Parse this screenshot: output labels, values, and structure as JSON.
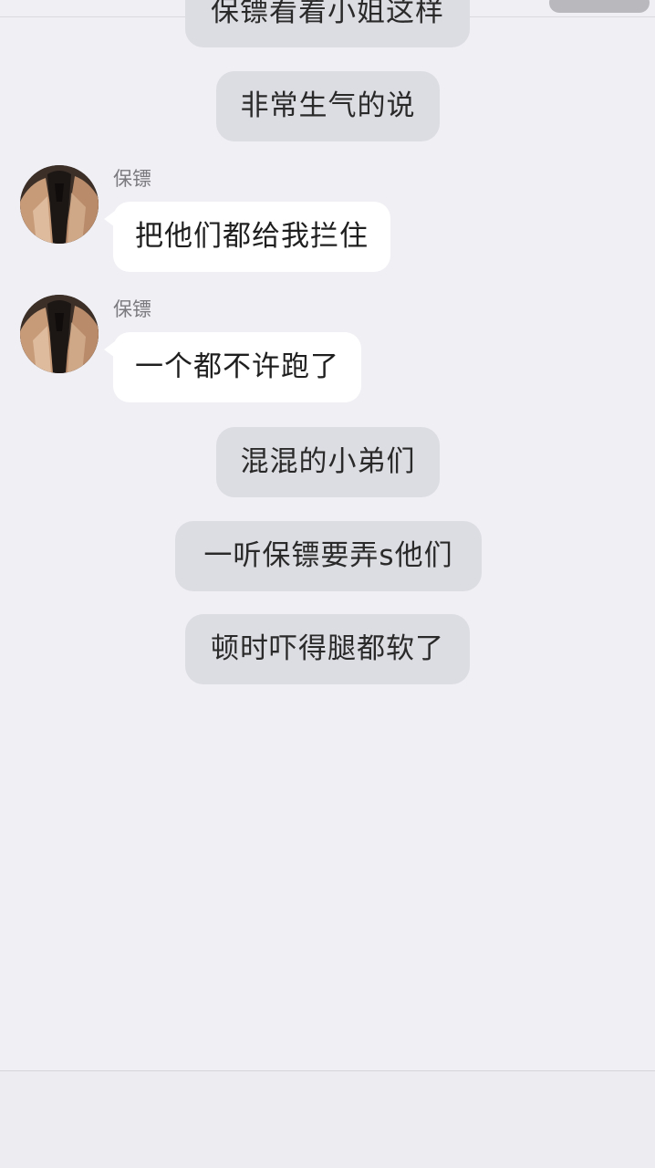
{
  "chat": {
    "narration_top_partial": "保镖看着小姐这样",
    "narration_1": "非常生气的说",
    "messages": [
      {
        "sender": "保镖",
        "text": "把他们都给我拦住"
      },
      {
        "sender": "保镖",
        "text": "一个都不许跑了"
      }
    ],
    "narration_2": "混混的小弟们",
    "narration_3": "一听保镖要弄s他们",
    "narration_4": "顿时吓得腿都软了"
  },
  "colors": {
    "background": "#efeff4",
    "narration_bubble": "#dcdce3",
    "message_bubble": "#ffffff"
  },
  "icons": {
    "avatar": "bodyguard-avatar-image"
  }
}
